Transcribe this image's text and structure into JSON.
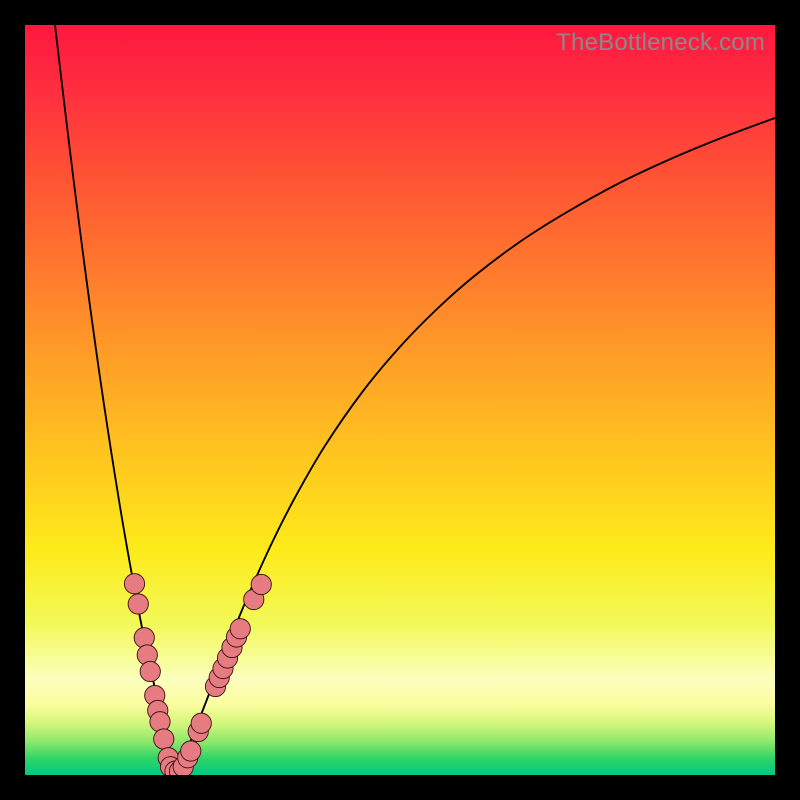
{
  "watermark": "TheBottleneck.com",
  "colors": {
    "frame": "#000000",
    "curve": "#000000",
    "marker_fill": "#e77b82",
    "marker_stroke": "#3a1214",
    "gradient_stops": [
      {
        "offset": 0.0,
        "color": "#ff183f"
      },
      {
        "offset": 0.09,
        "color": "#ff2f3f"
      },
      {
        "offset": 0.2,
        "color": "#ff5234"
      },
      {
        "offset": 0.33,
        "color": "#ff7a2d"
      },
      {
        "offset": 0.46,
        "color": "#ffa326"
      },
      {
        "offset": 0.58,
        "color": "#ffc71f"
      },
      {
        "offset": 0.7,
        "color": "#fdeb1a"
      },
      {
        "offset": 0.8,
        "color": "#f2f95a"
      },
      {
        "offset": 0.873,
        "color": "#fbffbe"
      },
      {
        "offset": 0.905,
        "color": "#fbfda0"
      },
      {
        "offset": 0.93,
        "color": "#d6f77c"
      },
      {
        "offset": 0.955,
        "color": "#8fe86e"
      },
      {
        "offset": 0.978,
        "color": "#2fd565"
      },
      {
        "offset": 1.0,
        "color": "#04c785"
      }
    ]
  },
  "chart_data": {
    "type": "line",
    "title": "",
    "xlabel": "",
    "ylabel": "",
    "x_range": [
      0,
      100
    ],
    "y_range": [
      0,
      100
    ],
    "curve_minimum": {
      "x": 20,
      "y": 0
    },
    "series": [
      {
        "name": "left-branch",
        "x": [
          4,
          5,
          6,
          7,
          8,
          9,
          10,
          11,
          12,
          13,
          14,
          15,
          16,
          17,
          18,
          19,
          20
        ],
        "y": [
          100,
          91.5,
          83.2,
          75.2,
          67.5,
          60.1,
          53.0,
          46.3,
          39.9,
          33.8,
          28.1,
          22.7,
          17.7,
          13.0,
          8.7,
          4.7,
          1.0
        ]
      },
      {
        "name": "right-branch",
        "x": [
          20,
          22,
          24,
          26,
          28,
          30,
          33,
          36,
          40,
          45,
          50,
          55,
          60,
          66,
          72,
          79,
          86,
          93,
          100
        ],
        "y": [
          1.0,
          4.4,
          9.4,
          14.6,
          19.7,
          24.5,
          31.1,
          37.0,
          43.9,
          51.1,
          57.1,
          62.2,
          66.6,
          71.1,
          74.9,
          78.8,
          82.1,
          85.0,
          87.6
        ]
      }
    ],
    "markers": {
      "name": "highlighted-points",
      "points": [
        {
          "x": 14.6,
          "y": 25.5
        },
        {
          "x": 15.1,
          "y": 22.8
        },
        {
          "x": 15.9,
          "y": 18.3
        },
        {
          "x": 16.3,
          "y": 16.0
        },
        {
          "x": 16.7,
          "y": 13.8
        },
        {
          "x": 17.3,
          "y": 10.6
        },
        {
          "x": 17.7,
          "y": 8.6
        },
        {
          "x": 18.0,
          "y": 7.1
        },
        {
          "x": 18.5,
          "y": 4.8
        },
        {
          "x": 19.1,
          "y": 2.3
        },
        {
          "x": 19.4,
          "y": 1.1
        },
        {
          "x": 20.0,
          "y": 0.5
        },
        {
          "x": 20.6,
          "y": 0.5
        },
        {
          "x": 21.1,
          "y": 1.1
        },
        {
          "x": 21.7,
          "y": 2.3
        },
        {
          "x": 22.1,
          "y": 3.2
        },
        {
          "x": 23.1,
          "y": 5.8
        },
        {
          "x": 23.5,
          "y": 6.9
        },
        {
          "x": 25.4,
          "y": 11.8
        },
        {
          "x": 25.9,
          "y": 13.0
        },
        {
          "x": 26.4,
          "y": 14.2
        },
        {
          "x": 27.0,
          "y": 15.6
        },
        {
          "x": 27.6,
          "y": 17.0
        },
        {
          "x": 28.2,
          "y": 18.4
        },
        {
          "x": 28.7,
          "y": 19.5
        },
        {
          "x": 30.5,
          "y": 23.4
        },
        {
          "x": 31.5,
          "y": 25.4
        }
      ]
    }
  }
}
